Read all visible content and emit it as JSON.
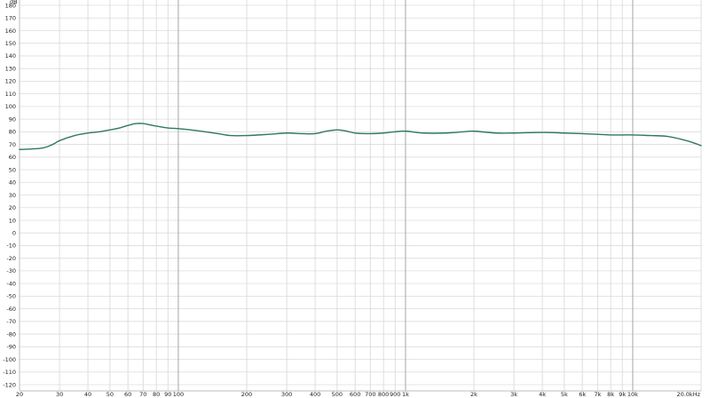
{
  "chart_data": {
    "type": "line",
    "title": "",
    "xlabel": "",
    "ylabel": "",
    "y_unit": "dB",
    "x_scale": "log",
    "xlim": [
      20,
      20000
    ],
    "ylim": [
      -130,
      180
    ],
    "grid": true,
    "legend": "none",
    "y_ticks": [
      180,
      170,
      160,
      150,
      140,
      130,
      120,
      110,
      100,
      90,
      80,
      70,
      60,
      50,
      40,
      30,
      20,
      10,
      0,
      -10,
      -20,
      -30,
      -40,
      -50,
      -60,
      -70,
      -80,
      -90,
      -100,
      -110,
      -120
    ],
    "y_tick_labels": [
      "180",
      "170",
      "160",
      "150",
      "140",
      "130",
      "120",
      "110",
      "100",
      "90",
      "80",
      "70",
      "60",
      "50",
      "40",
      "30",
      "20",
      "10",
      "0",
      "-10",
      "-20",
      "-30",
      "-40",
      "-50",
      "-60",
      "-70",
      "-80",
      "-90",
      "-100",
      "-110",
      "-120"
    ],
    "x_ticks": [
      20,
      30,
      40,
      50,
      60,
      70,
      80,
      90,
      100,
      200,
      300,
      400,
      500,
      600,
      700,
      800,
      900,
      1000,
      2000,
      3000,
      4000,
      5000,
      6000,
      7000,
      8000,
      9000,
      10000,
      20000
    ],
    "x_tick_labels": [
      "20",
      "30",
      "40",
      "50",
      "60",
      "70",
      "80",
      "90",
      "100",
      "200",
      "300",
      "400",
      "500",
      "600",
      "700",
      "800",
      "900",
      "1k",
      "2k",
      "3k",
      "4k",
      "5k",
      "6k",
      "7k",
      "8k",
      "9k",
      "10k",
      "20.0kHz"
    ],
    "x_major": [
      100,
      1000,
      10000
    ],
    "series": [
      {
        "color": "#2e7a5e",
        "x": [
          20,
          25,
          28,
          30,
          35,
          40,
          45,
          50,
          55,
          60,
          65,
          70,
          75,
          80,
          90,
          100,
          120,
          150,
          170,
          200,
          250,
          300,
          350,
          400,
          450,
          500,
          550,
          600,
          700,
          800,
          900,
          1000,
          1200,
          1500,
          1800,
          2000,
          2500,
          3000,
          4000,
          5000,
          6000,
          7000,
          8000,
          10000,
          12000,
          14000,
          16000,
          18000,
          20000
        ],
        "y": [
          66,
          67,
          70,
          73,
          77,
          79,
          80,
          81.5,
          83,
          85,
          86.5,
          86.5,
          85.5,
          84.5,
          83,
          82.5,
          81,
          78.5,
          77,
          77,
          78,
          79,
          78.5,
          78.5,
          80.5,
          81.5,
          80.5,
          79,
          78.5,
          79,
          80,
          80.5,
          79,
          79,
          80,
          80.5,
          79,
          79,
          79.5,
          79,
          78.5,
          78,
          77.5,
          77.5,
          77,
          76.5,
          74.5,
          72,
          69
        ]
      }
    ]
  }
}
